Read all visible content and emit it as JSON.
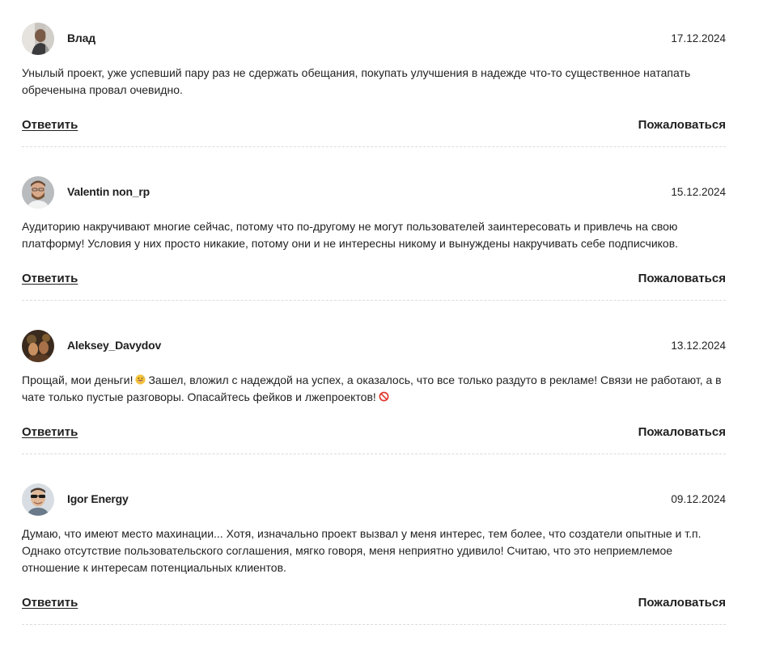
{
  "comments": [
    {
      "author": "Влад",
      "date": "17.12.2024",
      "text": "Унылый проект, уже успевший пару раз не сдержать обещания, покупать улучшения в надежде что-то существенное натапать обреченына провал очевидно.",
      "reply_label": "Ответить",
      "report_label": "Пожаловаться"
    },
    {
      "author": "Valentin non_rp",
      "date": "15.12.2024",
      "text": "Аудиторию накручивают многие сейчас, потому что по-другому не могут пользователей заинтересовать и привлечь на свою платформу! Условия у них просто никакие, потому они и не интересны никому и вынуждены накручивать себе подписчиков.",
      "reply_label": "Ответить",
      "report_label": "Пожаловаться"
    },
    {
      "author": "Aleksey_Davydov",
      "date": "13.12.2024",
      "text_part1": "Прощай, мои деньги!",
      "text_part2": "Зашел, вложил с надеждой на успех, а оказалось, что все только раздуто в рекламе! Связи не работают, а в чате только пустые разговоры. Опасайтесь фейков и лжепроектов!",
      "emoji_1": "grinning-sweat-emoji",
      "emoji_2": "prohibited-emoji",
      "reply_label": "Ответить",
      "report_label": "Пожаловаться"
    },
    {
      "author": "Igor Energy",
      "date": "09.12.2024",
      "text": "Думаю, что имеют место махинации... Хотя, изначально проект вызвал у меня интерес, тем более, что создатели опытные и т.п. Однако отсутствие пользовательского соглашения, мягко говоря, меня неприятно удивило! Считаю, что это неприемлемое отношение к интересам потенциальных клиентов.",
      "reply_label": "Ответить",
      "report_label": "Пожаловаться"
    }
  ]
}
